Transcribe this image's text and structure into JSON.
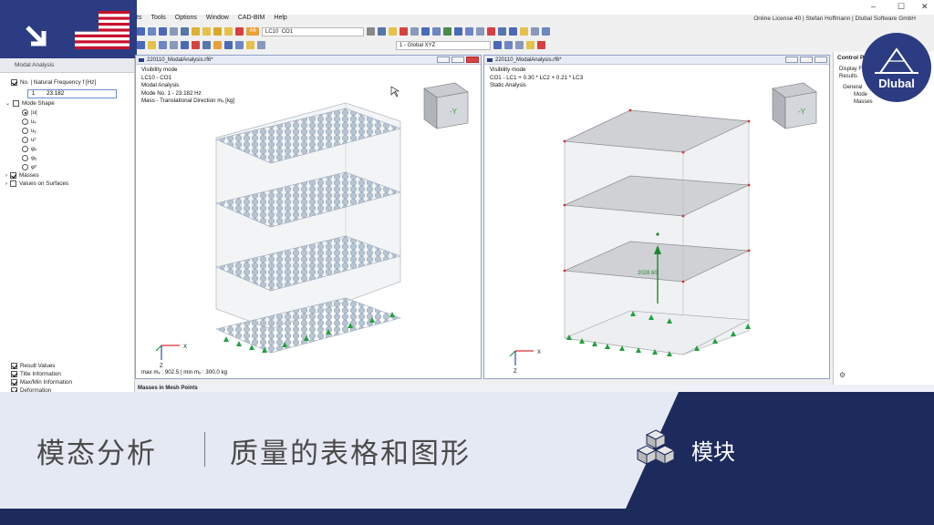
{
  "menu": [
    "ts",
    "Tools",
    "Options",
    "Window",
    "CAD-BIM",
    "Help"
  ],
  "license": "Online License 40 | Stefan Hoffmann | Dlubal Software GmbH",
  "toolbar": {
    "lc_badge": "A6",
    "lc_code": "LC10",
    "lc_name": "CO1",
    "view_combo": "1 - Global XYZ"
  },
  "navigator": {
    "title": "Modal Analysis",
    "freq_label": "No. | Natural Frequency f [Hz]",
    "freq_index": "1",
    "freq_value": "23.182",
    "mode_shape": "Mode Shape",
    "shapes": [
      "|u|",
      "uₓ",
      "uᵧ",
      "uᶻ",
      "φₓ",
      "φᵧ",
      "φᶻ"
    ],
    "masses": "Masses",
    "values_on_surfaces": "Values on Surfaces",
    "bottom": [
      "Result Values",
      "Title Information",
      "Max/Min Information",
      "Deformation"
    ]
  },
  "viewport_left": {
    "title": "220110_ModalAnalysis.rf6*",
    "lines": [
      "Visibility mode",
      "LC10 - CO1",
      "Modal Analysis",
      "Mode No. 1 - 23.182 Hz",
      "Mass - Translational Direction mₓ [kg]"
    ],
    "bottom": "max mₓ : 902.5 | min mₓ : 300.0 kg",
    "axis_x": "X",
    "axis_z": "Z"
  },
  "viewport_right": {
    "title": "220110_ModalAnalysis.rf6*",
    "lines": [
      "Visibility mode",
      "CO1 - LC1 + 0.30 * LC2 + 0.21 * LC3",
      "Static Analysis"
    ],
    "load_value": "2028.60",
    "axis_x": "X",
    "axis_z": "Z"
  },
  "control_panel": {
    "title": "Control Pa",
    "lines": [
      "Display F",
      "Results",
      "General",
      "Mode",
      "Masses"
    ]
  },
  "masses_bar": "Masses in Mesh Points",
  "brand": "Dlubal",
  "banner": {
    "title": "模态分析",
    "subtitle": "质量的表格和图形",
    "module": "模块"
  },
  "colors": {
    "brand_blue": "#2b3c83",
    "banner_bg": "#e5e9f3",
    "banner_dark": "#1d2a5c"
  }
}
